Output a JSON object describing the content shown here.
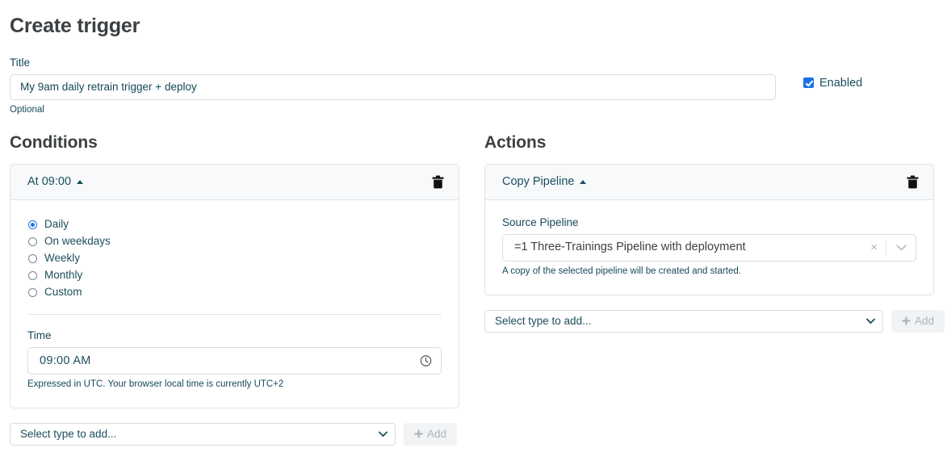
{
  "header": {
    "page_title": "Create trigger"
  },
  "title_field": {
    "label": "Title",
    "value": "My 9am daily retrain trigger + deploy",
    "placeholder": "",
    "help": "Optional"
  },
  "enabled": {
    "label": "Enabled",
    "checked": true,
    "accent_color": "#1a73e8"
  },
  "conditions": {
    "section_title": "Conditions",
    "card": {
      "header_title": "At 09:00",
      "collapse_icon": "caret-up-icon",
      "delete_icon": "trash-icon"
    },
    "schedule_options": [
      {
        "label": "Daily",
        "selected": true
      },
      {
        "label": "On weekdays",
        "selected": false
      },
      {
        "label": "Weekly",
        "selected": false
      },
      {
        "label": "Monthly",
        "selected": false
      },
      {
        "label": "Custom",
        "selected": false
      }
    ],
    "time": {
      "label": "Time",
      "value": "09:00 AM",
      "icon": "clock-icon",
      "help": "Expressed in UTC. Your browser local time is currently UTC+2"
    },
    "add_row": {
      "select_value": "Select type to add...",
      "add_label": "Add",
      "add_disabled": true
    }
  },
  "actions": {
    "section_title": "Actions",
    "card": {
      "header_title": "Copy Pipeline",
      "collapse_icon": "caret-up-icon",
      "delete_icon": "trash-icon"
    },
    "source_pipeline": {
      "label": "Source Pipeline",
      "value": "=1 Three-Trainings Pipeline with deployment",
      "clear_icon": "×",
      "help": "A copy of the selected pipeline will be created and started."
    },
    "add_row": {
      "select_value": "Select type to add...",
      "add_label": "Add",
      "add_disabled": true
    }
  }
}
